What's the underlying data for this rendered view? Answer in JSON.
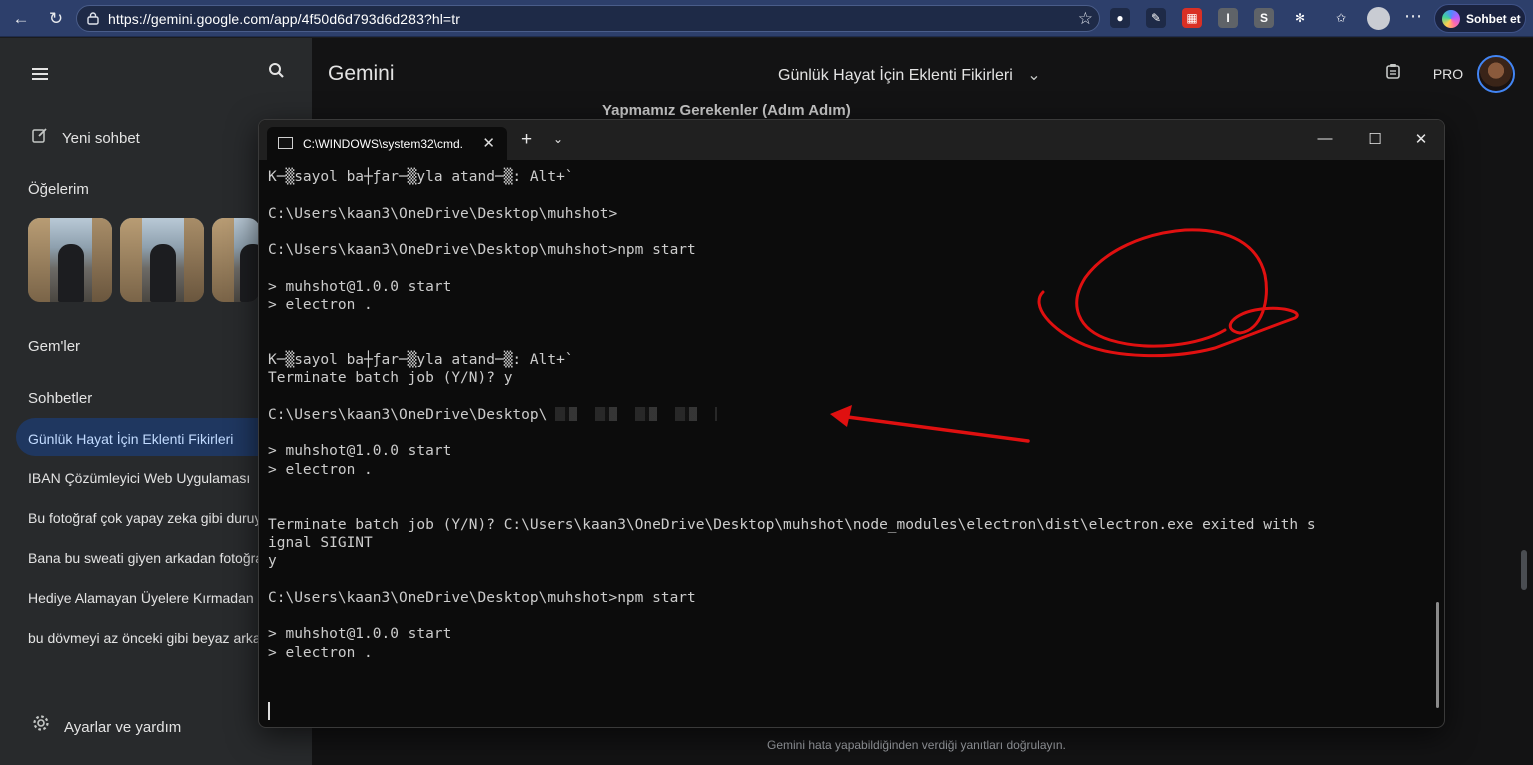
{
  "browser": {
    "url": "https://gemini.google.com/app/4f50d6d793d6d283?hl=tr",
    "chat_button_label": "Sohbet et",
    "back_icon": "←",
    "refresh_icon": "↻",
    "star_icon": "☆",
    "menu_icon": "⋯",
    "extensions": [
      {
        "name": "ext-binoculars-icon",
        "glyph": "●",
        "color": "#1e2a47"
      },
      {
        "name": "ext-pen-icon",
        "glyph": "✎",
        "color": "#1e2a47"
      },
      {
        "name": "ext-castle-icon",
        "glyph": "▦",
        "color": "#d93025"
      },
      {
        "name": "ext-i-icon",
        "glyph": "I",
        "color": "#5f6368"
      },
      {
        "name": "ext-s-icon",
        "glyph": "S",
        "color": "#5f6368"
      },
      {
        "name": "puzzle-icon",
        "glyph": "✻",
        "color": "transparent"
      },
      {
        "name": "favorites-icon",
        "glyph": "✩",
        "color": "transparent"
      }
    ]
  },
  "sidebar": {
    "new_chat": "Yeni sohbet",
    "items_title": "Öğelerim",
    "gems_title": "Gem'ler",
    "chats_title": "Sohbetler",
    "active_chat": "Günlük Hayat İçin Eklenti Fikirleri",
    "chats": [
      "IBAN Çözümleyici Web Uygulaması",
      "Bu fotoğraf çok yapay zeka gibi duruyor",
      "Bana bu sweati giyen arkadan fotoğraf",
      "Hediye Alamayan Üyelere Kırmadan Söyle",
      "bu dövmeyi az önceki gibi beyaz arka planla"
    ],
    "settings": "Ayarlar ve yardım"
  },
  "main": {
    "app_title": "Gemini",
    "conversation_title": "Günlük Hayat İçin Eklenti Fikirleri",
    "pro_badge": "PRO",
    "partial_heading": "Yapmamız Gerekenler (Adım Adım)",
    "footer_note": "Gemini hata yapabildiğinden verdiği yanıtları doğrulayın."
  },
  "cmd": {
    "tab_title": "C:\\WINDOWS\\system32\\cmd.",
    "close_glyph": "✕",
    "plus_glyph": "+",
    "dropdown_glyph": "⌄",
    "minimize_glyph": "—",
    "maximize_glyph": "☐",
    "lines": [
      "K─▒sayol ba┼ƒar─▒yla atand─▒: Alt+`",
      "",
      "C:\\Users\\kaan3\\OneDrive\\Desktop\\muhshot>",
      "",
      "C:\\Users\\kaan3\\OneDrive\\Desktop\\muhshot>npm start",
      "",
      "> muhshot@1.0.0 start",
      "> electron .",
      "",
      "",
      "K─▒sayol ba┼ƒar─▒yla atand─▒: Alt+`",
      "Terminate batch job (Y/N)? y",
      "",
      "C:\\Users\\kaan3\\OneDrive\\Desktop\\",
      "",
      "> muhshot@1.0.0 start",
      "> electron .",
      "",
      "",
      "Terminate batch job (Y/N)? C:\\Users\\kaan3\\OneDrive\\Desktop\\muhshot\\node_modules\\electron\\dist\\electron.exe exited with s",
      "ignal SIGINT",
      "y",
      "",
      "C:\\Users\\kaan3\\OneDrive\\Desktop\\muhshot>npm start",
      "",
      "> muhshot@1.0.0 start",
      "> electron ."
    ]
  },
  "colors": {
    "annotation_red": "#e01010",
    "browser_chrome": "#2d3f6b",
    "sidebar_bg": "#282a2c",
    "active_chat_bg": "#1f3760"
  }
}
